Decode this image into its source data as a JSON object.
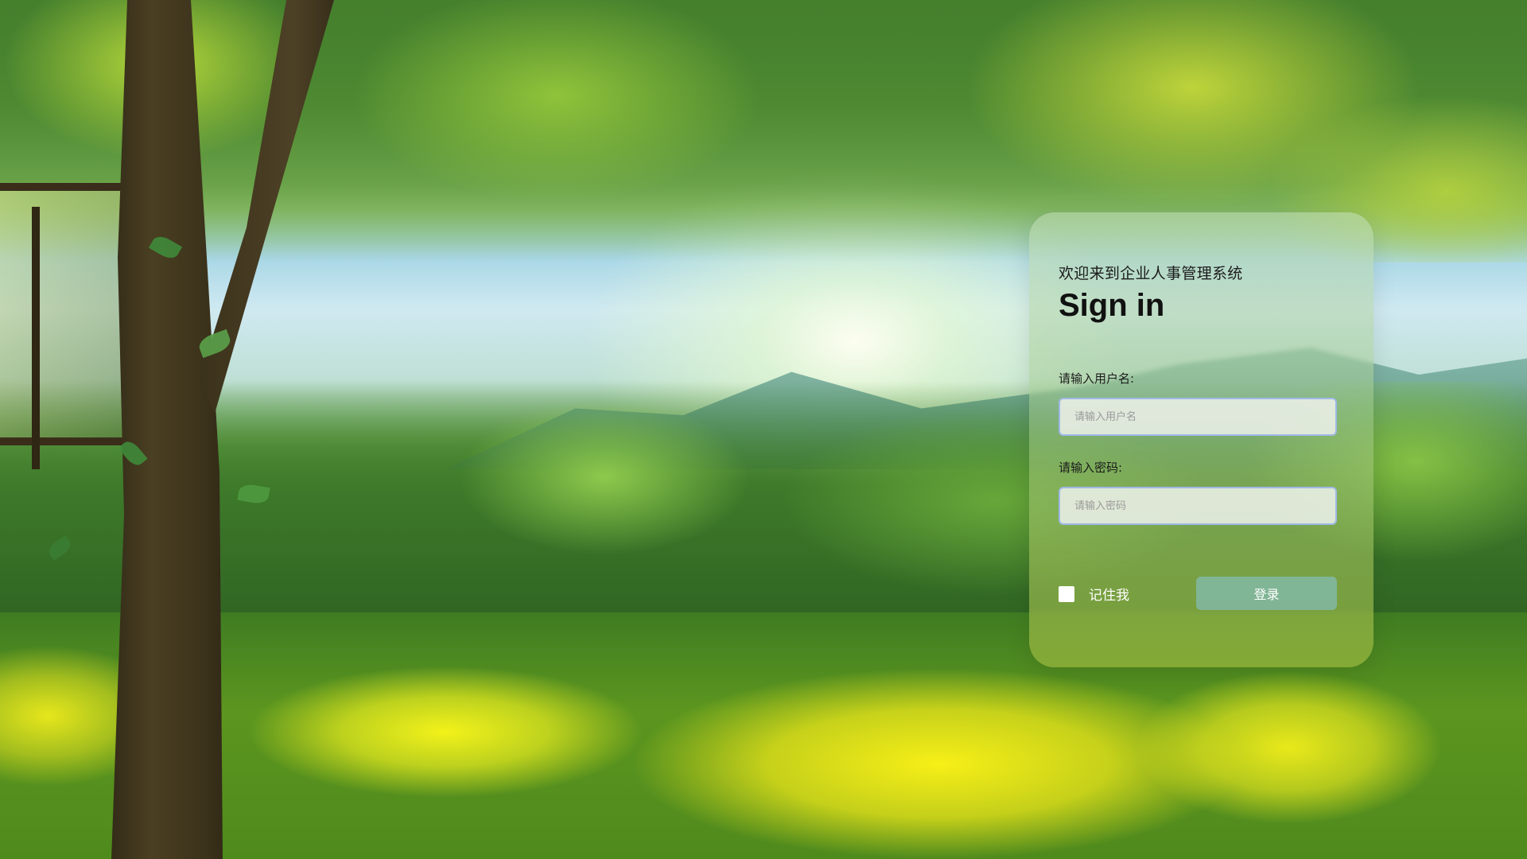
{
  "login": {
    "welcome": "欢迎来到企业人事管理系统",
    "title": "Sign in",
    "username_label": "请输入用户名:",
    "username_placeholder": "请输入用户名",
    "username_value": "",
    "password_label": "请输入密码:",
    "password_placeholder": "请输入密码",
    "password_value": "",
    "remember_label": "记住我",
    "remember_checked": false,
    "submit_label": "登录"
  },
  "colors": {
    "card_top": "#c3deb9",
    "card_bottom": "#96b43c",
    "input_border": "#9fb8e6",
    "button": "#82b9a5"
  }
}
